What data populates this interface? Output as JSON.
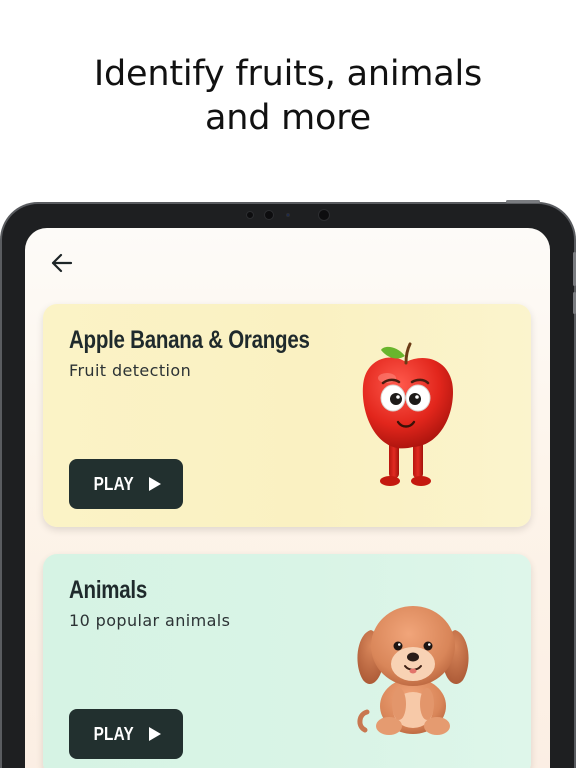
{
  "headline": {
    "line1": "Identify fruits, animals",
    "line2": "and more"
  },
  "colors": {
    "play_button": "#22302f",
    "fruit_card": "#fbf3c6",
    "animal_card": "#d6f3e4"
  },
  "cards": [
    {
      "title": "Apple Banana & Oranges",
      "subtitle": "Fruit detection",
      "button_label": "PLAY",
      "illustration": "apple-character"
    },
    {
      "title": "Animals",
      "subtitle": "10 popular animals",
      "button_label": "PLAY",
      "illustration": "puppy-character"
    }
  ]
}
